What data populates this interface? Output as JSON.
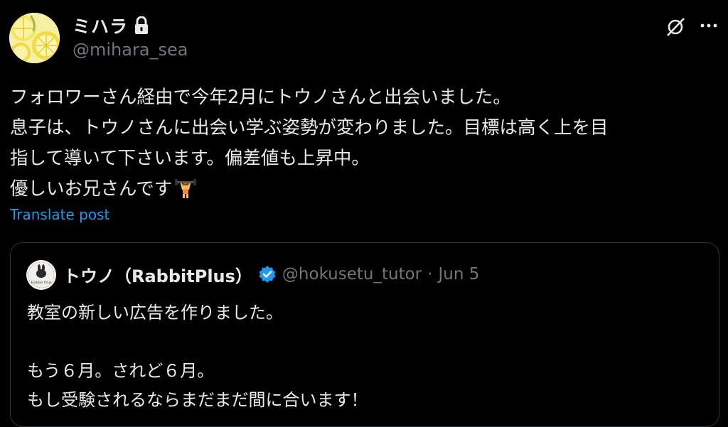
{
  "post": {
    "author": {
      "display_name": "ミハラ",
      "handle": "@mihara_sea",
      "protected_icon": "lock-icon",
      "avatar_icon": "lemon-slices-avatar"
    },
    "actions": {
      "grok_icon": "grok-icon",
      "more_icon": "more-dots-icon"
    },
    "text_lines": [
      "フォロワーさん経由で今年2月にトウノさんと出会いました。",
      "息子は、トウノさんに出会い学ぶ姿勢が変わりました。目標は高く上を目",
      "指して導いて下さいます。偏差値も上昇中。",
      "優しいお兄さんです"
    ],
    "emoji": "person-lifting-weights-emoji",
    "translate_label": "Translate post"
  },
  "quoted_post": {
    "display_name": "トウノ（RabbitPlus）",
    "handle": "@hokusetu_tutor",
    "separator": "·",
    "date": "Jun 5",
    "verified_icon": "verified-badge-icon",
    "avatar_icon": "rabbit-plus-logo",
    "avatar_text": "Rabbit Plus",
    "text_lines": [
      "教室の新しい広告を作りました。",
      "",
      "もう６月。されど６月。",
      "もし受験されるならまだまだ間に合います！"
    ]
  },
  "colors": {
    "background": "#000000",
    "text": "#e7e9ea",
    "secondary_text": "#71767b",
    "link": "#1d9bf0",
    "verified": "#1d9bf0",
    "border": "#2f3336"
  }
}
